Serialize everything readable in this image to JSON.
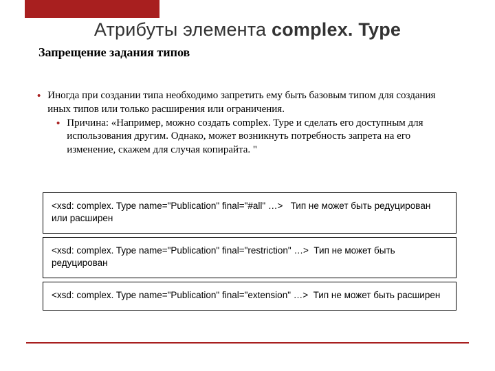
{
  "title_prefix": "Атрибуты элемента ",
  "title_bold": "complex. Type",
  "subhead": "Запрещение задания типов",
  "bullets": {
    "b1": "Иногда при создании типа необходимо запретить ему быть базовым типом для создания иных типов или только расширения или ограничения.",
    "b2": "Причина: «Например, можно создать complex. Type и сделать его доступным для использования другим.  Однако, может возникнуть потребность запрета на его изменение, скажем для случая копирайта. \""
  },
  "code": {
    "c1_code": "<xsd: complex. Type name=\"Publication\" final=\"#all\" …>",
    "c1_desc": "Тип не может быть редуцирован или расширен",
    "c2_code": "<xsd: complex. Type name=\"Publication\" final=\"restriction\" …>",
    "c2_desc": "Тип не может быть редуцирован",
    "c3_code": "<xsd: complex. Type name=\"Publication\" final=\"extension\" …>",
    "c3_desc": "Тип не может быть расширен"
  }
}
